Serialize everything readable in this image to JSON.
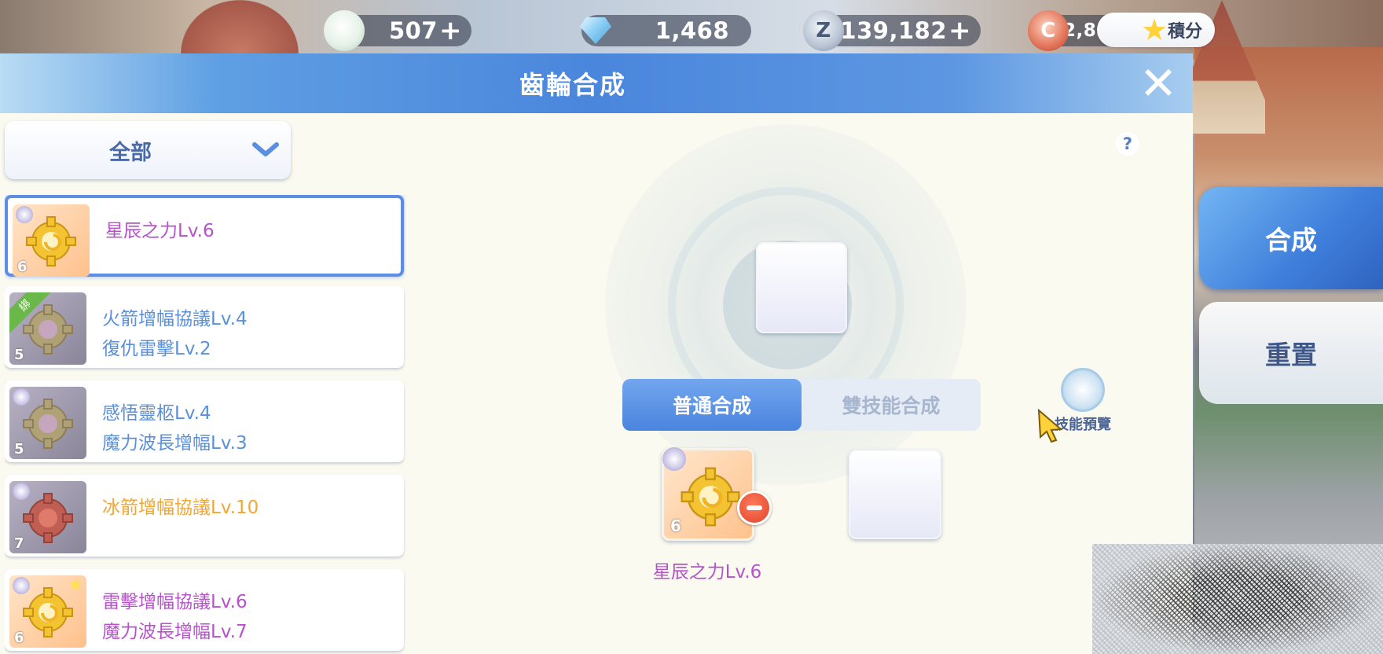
{
  "currencies": [
    {
      "name": "poring-points",
      "value": "507"
    },
    {
      "name": "diamonds",
      "value": "1,468"
    },
    {
      "name": "zeny",
      "value": "139,182"
    },
    {
      "name": "coins",
      "value": "12,833,683"
    }
  ],
  "score_label": "積分",
  "window": {
    "title": "齒輪合成"
  },
  "filter": {
    "selected": "全部"
  },
  "help_label": "?",
  "list": [
    {
      "line1": "星辰之力Lv.6",
      "line2": "",
      "level": "6",
      "color": "#b553c9",
      "selected": true,
      "bound": false,
      "starred": false
    },
    {
      "line1": "火箭增幅協議Lv.4",
      "line2": "復仇雷擊Lv.2",
      "level": "5",
      "color": "#5b8fd8",
      "selected": false,
      "bound": true,
      "starred": false
    },
    {
      "line1": "感悟靈柩Lv.4",
      "line2": "魔力波長增幅Lv.3",
      "level": "5",
      "color": "#5b8fd8",
      "selected": false,
      "bound": false,
      "starred": false
    },
    {
      "line1": "冰箭增幅協議Lv.10",
      "line2": "",
      "level": "7",
      "color": "#f0a737",
      "selected": false,
      "bound": false,
      "starred": false
    },
    {
      "line1": "雷擊增幅協議Lv.6",
      "line2": "魔力波長增幅Lv.7",
      "level": "6",
      "color": "#b553c9",
      "selected": false,
      "bound": false,
      "starred": true
    }
  ],
  "bound_tag": "綁",
  "modes": {
    "normal": "普通合成",
    "dual": "雙技能合成",
    "active": "normal"
  },
  "skill_preview_label": "技能預覽",
  "ingredient": {
    "name": "星辰之力Lv.6",
    "level": "6"
  },
  "actions": {
    "compose": "合成",
    "reset": "重置"
  },
  "colors": {
    "accent": "#4a86dc",
    "purple": "#b553c9",
    "blue": "#5b8fd8",
    "orange": "#f0a737"
  }
}
